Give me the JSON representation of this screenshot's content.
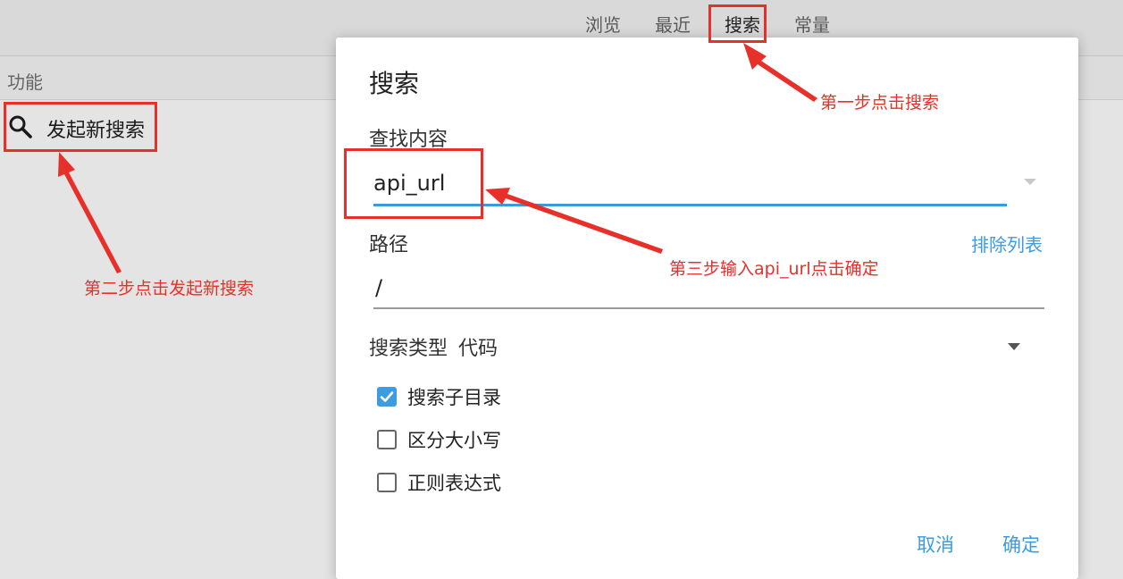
{
  "top_tabs": [
    {
      "label": "浏览"
    },
    {
      "label": "最近"
    },
    {
      "label": "搜索"
    },
    {
      "label": "常量"
    }
  ],
  "sidebar": {
    "header": "功能",
    "items": [
      {
        "label": "发起新搜索",
        "icon": "search-icon"
      }
    ]
  },
  "dialog": {
    "title": "搜索",
    "find_label": "查找内容",
    "find_value": "api_url",
    "path_label": "路径",
    "exclude_link": "排除列表",
    "path_value": "/",
    "search_type_label": "搜索类型",
    "search_type_value": "代码",
    "checkboxes": [
      {
        "label": "搜索子目录",
        "checked": true
      },
      {
        "label": "区分大小写",
        "checked": false
      },
      {
        "label": "正则表达式",
        "checked": false
      }
    ],
    "cancel_label": "取消",
    "ok_label": "确定"
  },
  "annotations": {
    "step1": "第一步点击搜索",
    "step2": "第二步点击发起新搜索",
    "step3": "第三步输入api_url点击确定",
    "color": "#e8302a"
  },
  "colors": {
    "accent": "#3d9be0",
    "annotation": "#e8302a"
  }
}
